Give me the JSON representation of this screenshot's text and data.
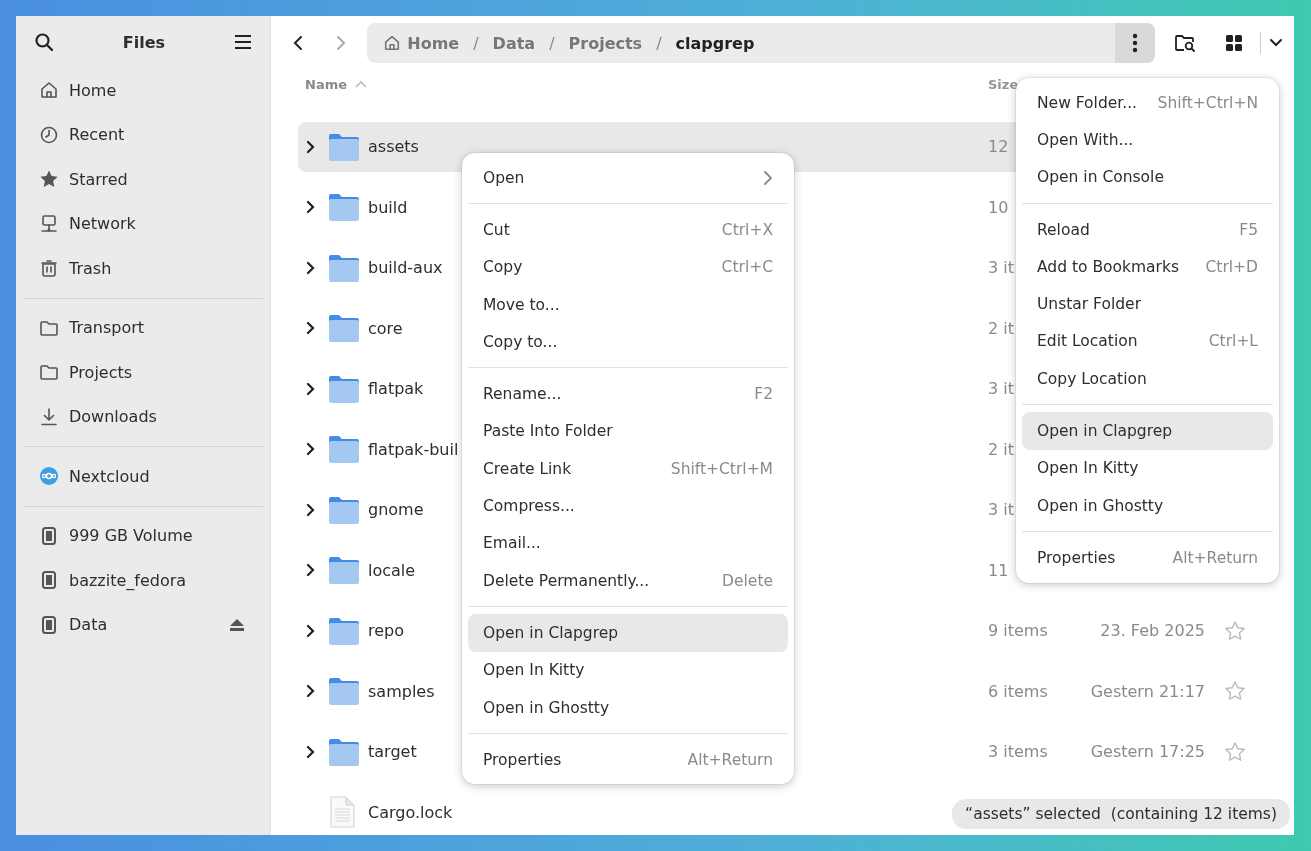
{
  "window": {
    "title": "Files"
  },
  "sidebar": {
    "sections": [
      [
        {
          "label": "Home",
          "kind": "home"
        },
        {
          "label": "Recent",
          "kind": "recent"
        },
        {
          "label": "Starred",
          "kind": "starred"
        },
        {
          "label": "Network",
          "kind": "network"
        },
        {
          "label": "Trash",
          "kind": "trash"
        }
      ],
      [
        {
          "label": "Transport",
          "kind": "folder"
        },
        {
          "label": "Projects",
          "kind": "folder"
        },
        {
          "label": "Downloads",
          "kind": "downloads"
        }
      ],
      [
        {
          "label": "Nextcloud",
          "kind": "cloud"
        }
      ],
      [
        {
          "label": "999 GB Volume",
          "kind": "drive",
          "ejectable": false
        },
        {
          "label": "bazzite_fedora",
          "kind": "drive",
          "ejectable": false
        },
        {
          "label": "Data",
          "kind": "drive",
          "ejectable": true
        }
      ]
    ]
  },
  "toolbar": {
    "back": {
      "disabled": false
    },
    "forward": {
      "disabled": true
    },
    "path": [
      {
        "text": "Home",
        "kind": "home"
      },
      {
        "text": "/",
        "kind": "separator"
      },
      {
        "text": "Data",
        "kind": "crumb"
      },
      {
        "text": "/",
        "kind": "separator"
      },
      {
        "text": "Projects",
        "kind": "crumb"
      },
      {
        "text": "/",
        "kind": "separator"
      },
      {
        "text": "clapgrep",
        "kind": "current"
      }
    ],
    "menu_button": {
      "active": true
    }
  },
  "columns": [
    {
      "label": "Name",
      "sorted": true
    },
    {
      "label": "Size",
      "sorted": false
    }
  ],
  "rows": [
    {
      "name": "assets",
      "kind": "folder",
      "selected": true,
      "size": "12"
    },
    {
      "name": "build",
      "kind": "folder",
      "selected": false,
      "size": "10"
    },
    {
      "name": "build-aux",
      "kind": "folder",
      "selected": false,
      "size": "3 it"
    },
    {
      "name": "core",
      "kind": "folder",
      "selected": false,
      "size": "2 it"
    },
    {
      "name": "flatpak",
      "kind": "folder",
      "selected": false,
      "size": "3 it"
    },
    {
      "name": "flatpak-buil",
      "kind": "folder",
      "selected": false,
      "size": "2 it"
    },
    {
      "name": "gnome",
      "kind": "folder",
      "selected": false,
      "size": "3 it"
    },
    {
      "name": "locale",
      "kind": "folder",
      "selected": false,
      "size": "11"
    },
    {
      "name": "repo",
      "kind": "folder",
      "selected": false,
      "size": "9 items",
      "date": "23. Feb 2025",
      "starred": false
    },
    {
      "name": "samples",
      "kind": "folder",
      "selected": false,
      "size": "6 items",
      "date": "Gestern 21:17",
      "starred": false
    },
    {
      "name": "target",
      "kind": "folder",
      "selected": false,
      "size": "3 items",
      "date": "Gestern 17:25",
      "starred": false
    },
    {
      "name": "Cargo.lock",
      "kind": "file",
      "selected": false
    }
  ],
  "context_menu": {
    "sections": [
      [
        {
          "label": "Open",
          "submenu": true,
          "selected": false
        }
      ],
      [
        {
          "label": "Cut",
          "shortcut": "Ctrl+X",
          "selected": false
        },
        {
          "label": "Copy",
          "shortcut": "Ctrl+C",
          "selected": false
        },
        {
          "label": "Move to...",
          "selected": false
        },
        {
          "label": "Copy to...",
          "selected": false
        }
      ],
      [
        {
          "label": "Rename...",
          "shortcut": "F2",
          "selected": false
        },
        {
          "label": "Paste Into Folder",
          "selected": false
        },
        {
          "label": "Create Link",
          "shortcut": "Shift+Ctrl+M",
          "selected": false
        },
        {
          "label": "Compress...",
          "selected": false
        },
        {
          "label": "Email...",
          "selected": false
        },
        {
          "label": "Delete Permanently...",
          "shortcut": "Delete",
          "selected": false
        }
      ],
      [
        {
          "label": "Open in Clapgrep",
          "selected": true
        },
        {
          "label": "Open In Kitty",
          "selected": false
        },
        {
          "label": "Open in Ghostty",
          "selected": false
        }
      ],
      [
        {
          "label": "Properties",
          "shortcut": "Alt+Return",
          "selected": false
        }
      ]
    ]
  },
  "folder_menu": {
    "sections": [
      [
        {
          "label": "New Folder...",
          "shortcut": "Shift+Ctrl+N",
          "selected": false
        },
        {
          "label": "Open With...",
          "selected": false
        },
        {
          "label": "Open in Console",
          "selected": false
        }
      ],
      [
        {
          "label": "Reload",
          "shortcut": "F5",
          "selected": false
        },
        {
          "label": "Add to Bookmarks",
          "shortcut": "Ctrl+D",
          "selected": false
        },
        {
          "label": "Unstar Folder",
          "selected": false
        },
        {
          "label": "Edit Location",
          "shortcut": "Ctrl+L",
          "selected": false
        },
        {
          "label": "Copy Location",
          "selected": false
        }
      ],
      [
        {
          "label": "Open in Clapgrep",
          "selected": true
        },
        {
          "label": "Open In Kitty",
          "selected": false
        },
        {
          "label": "Open in Ghostty",
          "selected": false
        }
      ],
      [
        {
          "label": "Properties",
          "shortcut": "Alt+Return",
          "selected": false
        }
      ]
    ]
  },
  "status_bar": {
    "text": "“assets” selected  (containing 12 items)"
  }
}
